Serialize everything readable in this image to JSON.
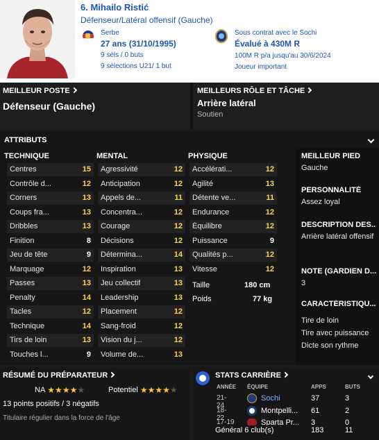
{
  "player": {
    "name": "6. Mihailo Ristić",
    "position": "Défenseur/Latéral offensif (Gauche)",
    "nationality": "Serbe",
    "age": "27 ans (31/10/1995)",
    "caps": "9 séls / 0 buts",
    "u21": "9 sélections U21/ 1 but",
    "contract": "Sous contrat avec le Sochi",
    "value": "Évalué à 430M R",
    "wage": "100M R p/a jusqu'au 30/6/2024",
    "squad_role": "Joueur important"
  },
  "best_position": {
    "label": "MEILLEUR POSTE",
    "value": "Défenseur (Gauche)"
  },
  "best_role": {
    "label": "MEILLEURS RÔLE ET TÂCHE",
    "value": "Arrière latéral",
    "duty": "Soutien"
  },
  "attributes_title": "ATTRIBUTS",
  "technical": {
    "title": "TECHNIQUE",
    "rows": [
      {
        "n": "Centres",
        "v": "15"
      },
      {
        "n": "Contrôle d...",
        "v": "12"
      },
      {
        "n": "Corners",
        "v": "13"
      },
      {
        "n": "Coups fra...",
        "v": "13"
      },
      {
        "n": "Dribbles",
        "v": "13"
      },
      {
        "n": "Finition",
        "v": "8"
      },
      {
        "n": "Jeu de tête",
        "v": "9"
      },
      {
        "n": "Marquage",
        "v": "12"
      },
      {
        "n": "Passes",
        "v": "13"
      },
      {
        "n": "Penalty",
        "v": "14"
      },
      {
        "n": "Tacles",
        "v": "12"
      },
      {
        "n": "Technique",
        "v": "14"
      },
      {
        "n": "Tirs de loin",
        "v": "13"
      },
      {
        "n": "Touches l...",
        "v": "9"
      }
    ]
  },
  "mental": {
    "title": "MENTAL",
    "rows": [
      {
        "n": "Agressivité",
        "v": "12"
      },
      {
        "n": "Anticipation",
        "v": "12"
      },
      {
        "n": "Appels de...",
        "v": "11"
      },
      {
        "n": "Concentra...",
        "v": "12"
      },
      {
        "n": "Courage",
        "v": "12"
      },
      {
        "n": "Décisions",
        "v": "12"
      },
      {
        "n": "Détermina...",
        "v": "14"
      },
      {
        "n": "Inspiration",
        "v": "13"
      },
      {
        "n": "Jeu collectif",
        "v": "13"
      },
      {
        "n": "Leadership",
        "v": "13"
      },
      {
        "n": "Placement",
        "v": "12"
      },
      {
        "n": "Sang-froid",
        "v": "12"
      },
      {
        "n": "Vision du j...",
        "v": "12"
      },
      {
        "n": "Volume de...",
        "v": "13"
      }
    ]
  },
  "physical": {
    "title": "PHYSIQUE",
    "rows": [
      {
        "n": "Accélérati...",
        "v": "12"
      },
      {
        "n": "Agilité",
        "v": "13"
      },
      {
        "n": "Détente ve...",
        "v": "11"
      },
      {
        "n": "Endurance",
        "v": "12"
      },
      {
        "n": "Équilibre",
        "v": "12"
      },
      {
        "n": "Puissance",
        "v": "9"
      },
      {
        "n": "Qualités p...",
        "v": "12"
      },
      {
        "n": "Vitesse",
        "v": "12"
      }
    ],
    "height_label": "Taille",
    "height": "180 cm",
    "weight_label": "Poids",
    "weight": "77 kg"
  },
  "side": {
    "foot_title": "MEILLEUR PIED",
    "foot": "Gauche",
    "pers_title": "PERSONNALITÉ",
    "pers": "Assez loyal",
    "desc_title": "DESCRIPTION DES...",
    "desc": "Arrière latéral offensif",
    "gk_title": "NOTE (GARDIEN D...",
    "gk": "3",
    "traits_title": "CARACTÉRISTIQU...",
    "traits": [
      "Tire de loin",
      "Tire avec puissance",
      "Dicte son rythme"
    ]
  },
  "coach": {
    "title": "RÉSUMÉ DU PRÉPARATEUR",
    "na": "NA",
    "na_stars": 3.5,
    "potential": "Potentiel",
    "pot_stars": 3.5,
    "points": "13 points positifs / 3 négatifs",
    "summary": "Titulaire régulier dans la force de l'âge"
  },
  "career": {
    "title": "STATS CARRIÈRE",
    "h_year": "ANNÉE",
    "h_team": "ÉQUIPE",
    "h_apps": "APPS",
    "h_goals": "BUTS",
    "rows": [
      {
        "year": "21-24",
        "team": "Sochi",
        "apps": "37",
        "goals": "3"
      },
      {
        "year": "18-22",
        "team": "Montpelli...",
        "apps": "61",
        "goals": "2"
      },
      {
        "year": "17-19",
        "team": "Sparta Pr...",
        "apps": "3",
        "goals": "0"
      }
    ],
    "total_label": "Général 6 club(s)",
    "total_apps": "183",
    "total_goals": "11"
  },
  "colors": {
    "accent": "#1c56b6",
    "high": "#ffd54a",
    "career_icon": "#2b61d6"
  }
}
